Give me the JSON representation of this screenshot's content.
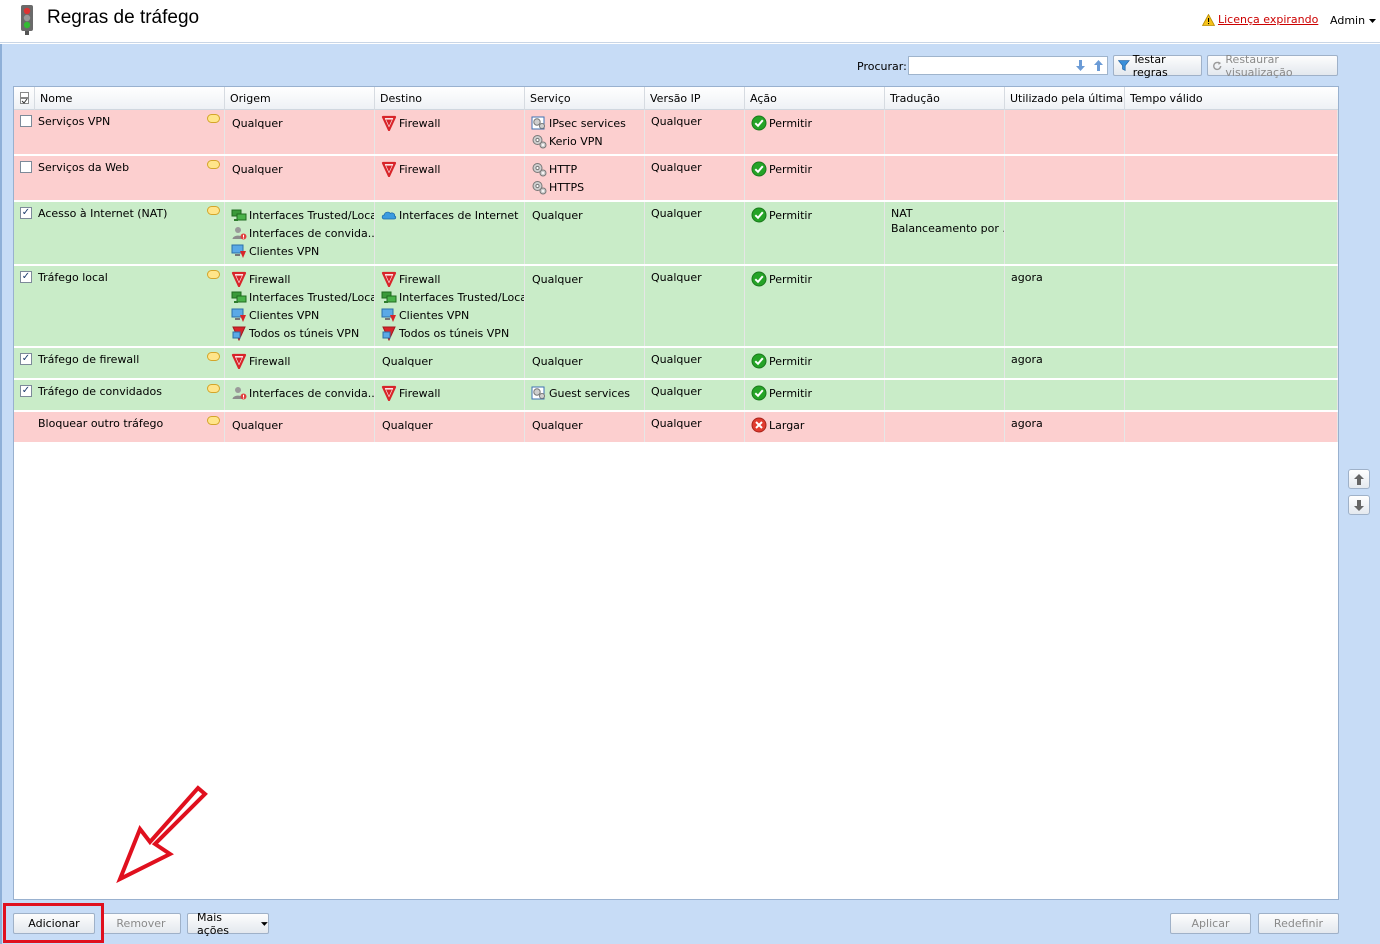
{
  "header": {
    "title": "Regras de tráfego",
    "license_warning": "Licença expirando",
    "user_menu": "Admin"
  },
  "toolbar": {
    "search_label": "Procurar:",
    "search_value": "",
    "test_rules": "Testar regras",
    "restore_view": "Restaurar visualização"
  },
  "columns": [
    "Nome",
    "Origem",
    "Destino",
    "Serviço",
    "Versão IP",
    "Ação",
    "Tradução",
    "Utilizado pela última ...",
    "Tempo válido"
  ],
  "rules": [
    {
      "color": "red",
      "checked": false,
      "has_checkbox": true,
      "name": "Serviços VPN",
      "source": [
        {
          "icon": "any",
          "text": "Qualquer"
        }
      ],
      "destination": [
        {
          "icon": "firewall-icon",
          "text": "Firewall"
        }
      ],
      "service": [
        {
          "icon": "service-group-icon",
          "text": "IPsec services"
        },
        {
          "icon": "gear-icon",
          "text": "Kerio VPN"
        }
      ],
      "ip_version": "Qualquer",
      "action": {
        "icon": "permit-icon",
        "text": "Permitir"
      },
      "translation": [],
      "last_used": "",
      "valid_time": ""
    },
    {
      "color": "red",
      "checked": false,
      "has_checkbox": true,
      "name": "Serviços da Web",
      "source": [
        {
          "icon": "any",
          "text": "Qualquer"
        }
      ],
      "destination": [
        {
          "icon": "firewall-icon",
          "text": "Firewall"
        }
      ],
      "service": [
        {
          "icon": "gear-icon",
          "text": "HTTP"
        },
        {
          "icon": "gear-icon",
          "text": "HTTPS"
        }
      ],
      "ip_version": "Qualquer",
      "action": {
        "icon": "permit-icon",
        "text": "Permitir"
      },
      "translation": [],
      "last_used": "",
      "valid_time": ""
    },
    {
      "color": "green",
      "checked": true,
      "has_checkbox": true,
      "name": "Acesso à Internet (NAT)",
      "source": [
        {
          "icon": "network-icon",
          "text": "Interfaces Trusted/Local"
        },
        {
          "icon": "guest-icon",
          "text": "Interfaces de convida..."
        },
        {
          "icon": "vpn-clients-icon",
          "text": "Clientes VPN"
        }
      ],
      "destination": [
        {
          "icon": "cloud-icon",
          "text": "Interfaces de Internet"
        }
      ],
      "service": [
        {
          "icon": "any",
          "text": "Qualquer"
        }
      ],
      "ip_version": "Qualquer",
      "action": {
        "icon": "permit-icon",
        "text": "Permitir"
      },
      "translation": [
        "NAT",
        "Balanceamento por ..."
      ],
      "last_used": "",
      "valid_time": ""
    },
    {
      "color": "green",
      "checked": true,
      "has_checkbox": true,
      "name": "Tráfego local",
      "source": [
        {
          "icon": "firewall-icon",
          "text": "Firewall"
        },
        {
          "icon": "network-icon",
          "text": "Interfaces Trusted/Local"
        },
        {
          "icon": "vpn-clients-icon",
          "text": "Clientes VPN"
        },
        {
          "icon": "vpn-tunnels-icon",
          "text": "Todos os túneis VPN"
        }
      ],
      "destination": [
        {
          "icon": "firewall-icon",
          "text": "Firewall"
        },
        {
          "icon": "network-icon",
          "text": "Interfaces Trusted/Local"
        },
        {
          "icon": "vpn-clients-icon",
          "text": "Clientes VPN"
        },
        {
          "icon": "vpn-tunnels-icon",
          "text": "Todos os túneis VPN"
        }
      ],
      "service": [
        {
          "icon": "any",
          "text": "Qualquer"
        }
      ],
      "ip_version": "Qualquer",
      "action": {
        "icon": "permit-icon",
        "text": "Permitir"
      },
      "translation": [],
      "last_used": "agora",
      "valid_time": ""
    },
    {
      "color": "green",
      "checked": true,
      "has_checkbox": true,
      "name": "Tráfego de firewall",
      "source": [
        {
          "icon": "firewall-icon",
          "text": "Firewall"
        }
      ],
      "destination": [
        {
          "icon": "any",
          "text": "Qualquer"
        }
      ],
      "service": [
        {
          "icon": "any",
          "text": "Qualquer"
        }
      ],
      "ip_version": "Qualquer",
      "action": {
        "icon": "permit-icon",
        "text": "Permitir"
      },
      "translation": [],
      "last_used": "agora",
      "valid_time": ""
    },
    {
      "color": "green",
      "checked": true,
      "has_checkbox": true,
      "name": "Tráfego de convidados",
      "source": [
        {
          "icon": "guest-icon",
          "text": "Interfaces de convida..."
        }
      ],
      "destination": [
        {
          "icon": "firewall-icon",
          "text": "Firewall"
        }
      ],
      "service": [
        {
          "icon": "service-group-icon",
          "text": "Guest services"
        }
      ],
      "ip_version": "Qualquer",
      "action": {
        "icon": "permit-icon",
        "text": "Permitir"
      },
      "translation": [],
      "last_used": "",
      "valid_time": ""
    },
    {
      "color": "red",
      "checked": false,
      "has_checkbox": false,
      "name": "Bloquear outro tráfego",
      "source": [
        {
          "icon": "any",
          "text": "Qualquer"
        }
      ],
      "destination": [
        {
          "icon": "any",
          "text": "Qualquer"
        }
      ],
      "service": [
        {
          "icon": "any",
          "text": "Qualquer"
        }
      ],
      "ip_version": "Qualquer",
      "action": {
        "icon": "drop-icon",
        "text": "Largar"
      },
      "translation": [],
      "last_used": "agora",
      "valid_time": ""
    }
  ],
  "footer": {
    "add": "Adicionar",
    "remove": "Remover",
    "more_actions": "Mais ações",
    "apply": "Aplicar",
    "reset": "Redefinir"
  },
  "colors": {
    "row_red": "#fccfcf",
    "row_green": "#c9ecc8",
    "background_blue": "#c7dcf6",
    "highlight_red": "#e0101e"
  }
}
